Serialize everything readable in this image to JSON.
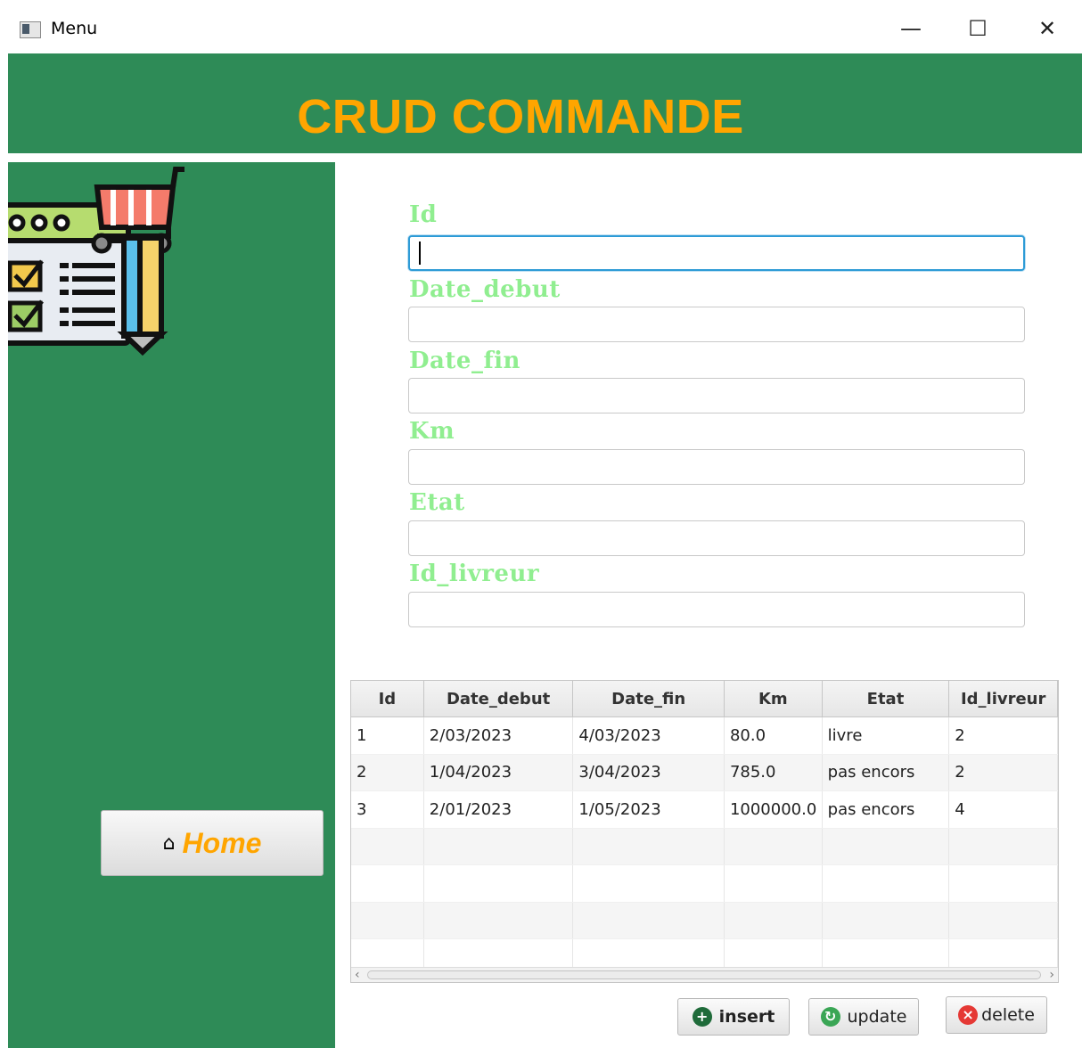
{
  "window": {
    "title": "Menu",
    "minimize": "—",
    "maximize": "☐",
    "close": "✕"
  },
  "header": {
    "title": "CRUD COMMANDE"
  },
  "sidebar": {
    "home_label": "Home"
  },
  "form": {
    "fields": [
      {
        "label": "Id",
        "value": ""
      },
      {
        "label": "Date_debut",
        "value": ""
      },
      {
        "label": "Date_fin",
        "value": ""
      },
      {
        "label": "Km",
        "value": ""
      },
      {
        "label": "Etat",
        "value": ""
      },
      {
        "label": "Id_livreur",
        "value": ""
      }
    ]
  },
  "table": {
    "columns": [
      "Id",
      "Date_debut",
      "Date_fin",
      "Km",
      "Etat",
      "Id_livreur"
    ],
    "rows": [
      [
        "1",
        "2/03/2023",
        "4/03/2023",
        "80.0",
        "livre",
        "2"
      ],
      [
        "2",
        "1/04/2023",
        "3/04/2023",
        "785.0",
        "pas encors",
        "2"
      ],
      [
        "3",
        "2/01/2023",
        "1/05/2023",
        "1000000.0",
        "pas encors",
        "4"
      ]
    ]
  },
  "actions": {
    "insert": "insert",
    "update": "update",
    "delete": "delete"
  },
  "colors": {
    "green": "#2e8b57",
    "orange": "#ffa500",
    "label_green": "#90ee90"
  }
}
